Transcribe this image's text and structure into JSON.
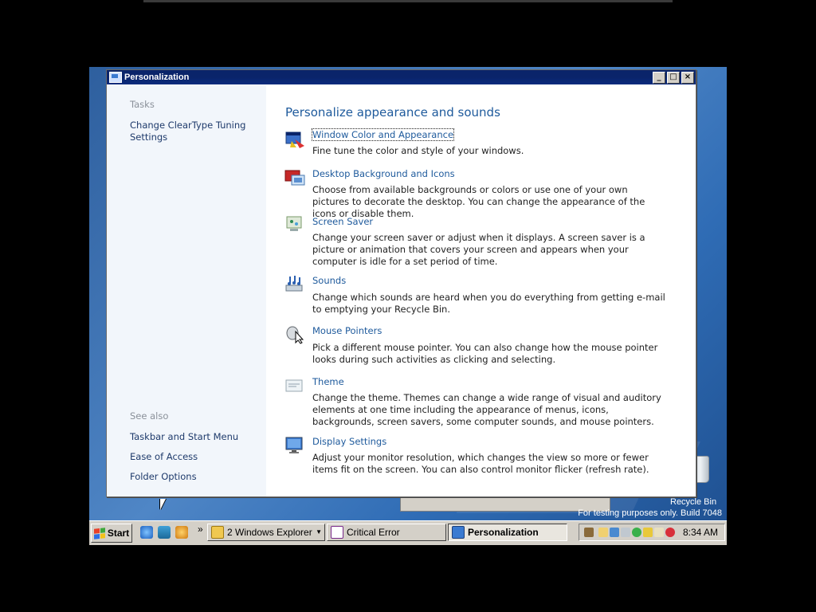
{
  "window": {
    "title": "Personalization",
    "controls": [
      "_",
      "□",
      "×"
    ]
  },
  "sidebar": {
    "tasks_heading": "Tasks",
    "tasks": [
      "Change ClearType Tuning Settings"
    ],
    "see_also_heading": "See also",
    "see_also": [
      "Taskbar and Start Menu",
      "Ease of Access",
      "Folder Options"
    ]
  },
  "main": {
    "title": "Personalize appearance and sounds",
    "items": [
      {
        "icon": "window-color-icon",
        "title": "Window Color and Appearance",
        "description": "Fine tune the color and style of your windows."
      },
      {
        "icon": "desktop-background-icon",
        "title": "Desktop Background and Icons",
        "description": "Choose from available backgrounds or colors or use one of your own pictures to decorate the desktop. You can change the appearance of the icons or disable them."
      },
      {
        "icon": "screen-saver-icon",
        "title": "Screen Saver",
        "description": "Change your screen saver or adjust when it displays. A screen saver is a picture or animation that covers your screen and appears when your computer is idle for a set period of time."
      },
      {
        "icon": "sounds-icon",
        "title": "Sounds",
        "description": "Change which sounds are heard when you do everything from getting e-mail to emptying your Recycle Bin."
      },
      {
        "icon": "mouse-pointer-icon",
        "title": "Mouse Pointers",
        "description": "Pick a different mouse pointer. You can also change how the mouse pointer looks during such activities as clicking and selecting."
      },
      {
        "icon": "theme-icon",
        "title": "Theme",
        "description": "Change the theme. Themes can change a wide range of visual and auditory elements at one time including the appearance of menus, icons, backgrounds, screen savers, some computer sounds, and mouse pointers."
      },
      {
        "icon": "display-settings-icon",
        "title": "Display Settings",
        "description": "Adjust your monitor resolution, which changes the view so more or fewer items fit on the screen. You can also control monitor flicker (refresh rate)."
      }
    ]
  },
  "desktop": {
    "recycle_bin_label": "Recycle Bin",
    "build_text": "For testing purposes only. Build 7048"
  },
  "taskbar": {
    "start_label": "Start",
    "chevron": "»",
    "tasks": [
      {
        "label": "2 Windows Explorer",
        "icon": "folder-icon",
        "active": false
      },
      {
        "label": "Critical Error",
        "icon": "error-window-icon",
        "active": false
      },
      {
        "label": "Personalization",
        "icon": "personalization-icon",
        "active": true
      }
    ],
    "clock": "8:34 AM"
  },
  "colors": {
    "title_bar": "#0a246a",
    "link": "#1e5a9c",
    "sidebar_bg": "#f2f6fb",
    "taskbar_bg": "#d4d0c8"
  }
}
